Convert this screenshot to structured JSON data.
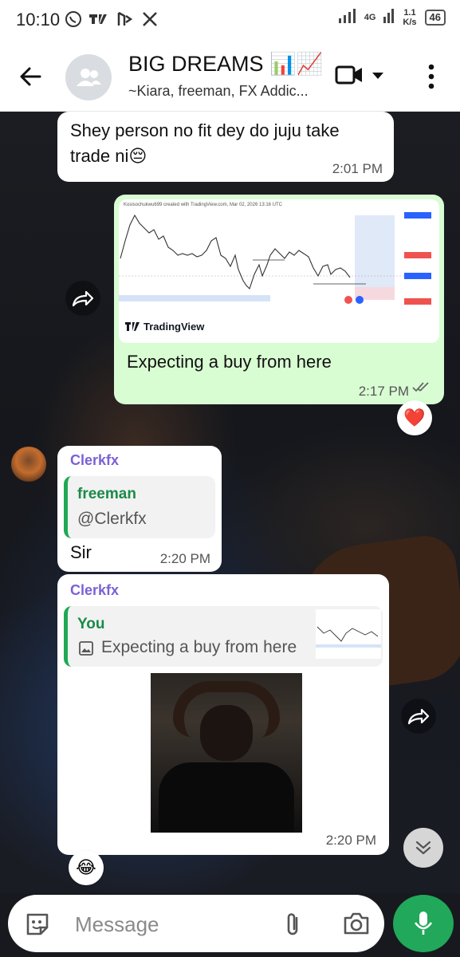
{
  "status_bar": {
    "time": "10:10",
    "network_top": "4G",
    "speed_value": "1.1",
    "speed_unit": "K/s",
    "battery": "46",
    "icons": [
      "whatsapp-icon",
      "tv-icon",
      "cube-icon",
      "x-logo-icon"
    ]
  },
  "header": {
    "title": "BIG DREAMS",
    "title_emoji": "📊📈",
    "subtitle": "~Kiara, freeman, FX Addic...",
    "icons": [
      "back-arrow-icon",
      "group-avatar-icon",
      "video-call-icon",
      "dropdown-icon",
      "more-vert-icon"
    ]
  },
  "messages": [
    {
      "id": "m1",
      "direction": "incoming",
      "text": "Shey person no fit dey do juju take trade ni",
      "emoji": "😔",
      "time": "2:01 PM"
    },
    {
      "id": "m2",
      "direction": "outgoing",
      "chart_header": "Kosisochukwu699 created with TradingView.com, Mar 02, 2026 13:16 UTC",
      "chart_brand": "TradingView",
      "text": "Expecting a buy from here",
      "time": "2:17 PM",
      "status": "read",
      "reaction": "❤️"
    },
    {
      "id": "m3",
      "direction": "incoming",
      "sender": "Clerkfx",
      "quote_name": "freeman",
      "quote_text": "@Clerkfx",
      "text": "Sir",
      "time": "2:20 PM"
    },
    {
      "id": "m4",
      "direction": "incoming",
      "sender": "Clerkfx",
      "quote_name": "You",
      "quote_text": "Expecting a buy from here",
      "time": "2:20 PM",
      "reaction": "😂"
    }
  ],
  "composer": {
    "placeholder": "Message",
    "icons": [
      "sticker-icon",
      "attach-icon",
      "camera-icon",
      "mic-icon"
    ]
  },
  "colors": {
    "outgoing_bubble": "#d9fdd3",
    "sender_name": "#7b61d6",
    "quote_accent": "#1fa855",
    "mic_button": "#21a85a"
  }
}
